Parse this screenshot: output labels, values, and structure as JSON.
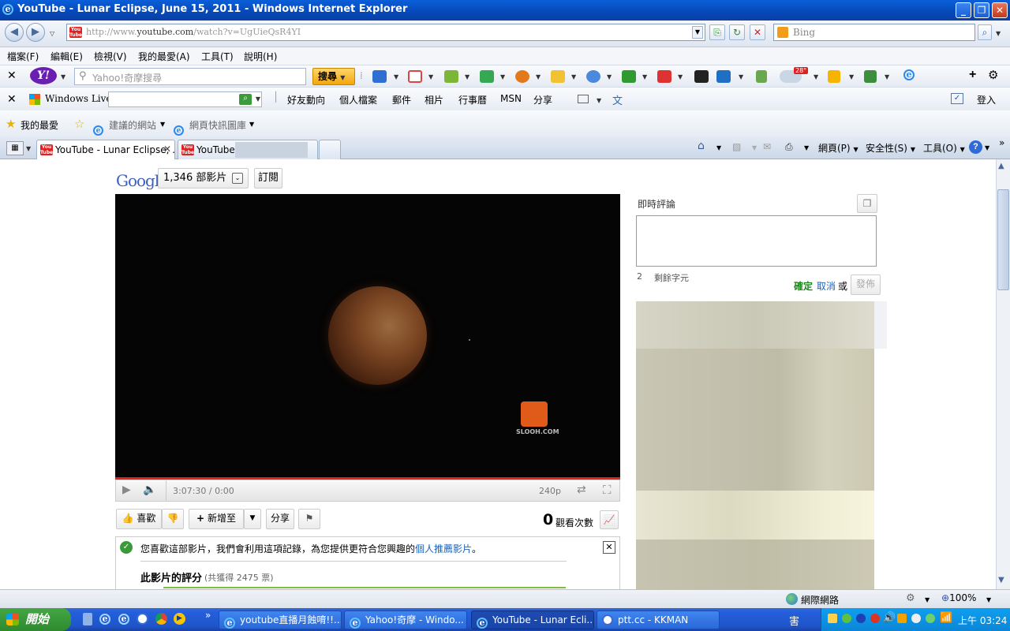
{
  "window": {
    "title": "YouTube - Lunar Eclipse, June 15, 2011 - Windows Internet Explorer",
    "minimize": "_",
    "restore": "❐",
    "close": "✕"
  },
  "address_bar": {
    "url_prefix": "http://www.",
    "url_domain": "youtube.com",
    "url_suffix": "/watch?v=UgUieQsR4YI",
    "search_placeholder": "Bing"
  },
  "menu": [
    "檔案(F)",
    "編輯(E)",
    "檢視(V)",
    "我的最愛(A)",
    "工具(T)",
    "說明(H)"
  ],
  "yahoo_bar": {
    "search_placeholder": "Yahoo!奇摩搜尋",
    "search_button": "搜尋",
    "weather_badge": "28°"
  },
  "live_bar": {
    "brand": "Windows Live",
    "links": [
      "好友動向",
      "個人檔案",
      "郵件",
      "相片",
      "行事曆",
      "MSN",
      "分享"
    ],
    "signin": "登入"
  },
  "favorites_bar": {
    "favorites": "我的最愛",
    "suggested_sites": "建議的網站",
    "web_slice_gallery": "網頁快訊圖庫"
  },
  "tabs": {
    "tab1": "YouTube - Lunar Eclipse, ...",
    "tab2": "YouTube -",
    "page_menu": "網頁(P)",
    "safety_menu": "安全性(S)",
    "tools_menu": "工具(O)"
  },
  "channel": {
    "name": "Google",
    "video_count": "1,346 部影片",
    "subscribe": "訂閱"
  },
  "player": {
    "time": "3:07:30 / 0:00",
    "quality": "240p",
    "watermark": "SLOOH.COM"
  },
  "actions": {
    "like": "喜歡",
    "add_to": "新增至",
    "share": "分享",
    "view_count": "0",
    "views_label": "觀看次數"
  },
  "notice": {
    "text": "您喜歡這部影片，我們會利用這項記錄，為您提供更符合您興趣的",
    "link": "個人推薦影片",
    "end": "。",
    "rating_title": "此影片的評分",
    "rating_votes": "(共獲得 2475 票)"
  },
  "live_comments": {
    "title": "即時評論",
    "chars_left_count": "2",
    "chars_left_label": "剩餘字元",
    "confirm": "確定",
    "cancel": "取消",
    "or": "或",
    "post": "發佈"
  },
  "status_bar": {
    "zone": "網際網路",
    "zoom": "100%"
  },
  "taskbar": {
    "start": "開始",
    "items": [
      "youtube直播月蝕唷!!...",
      "Yahoo!奇摩 - Windo...",
      "YouTube - Lunar Ecli...",
      "ptt.cc - KKMAN"
    ],
    "clock": "上午 03:24"
  }
}
